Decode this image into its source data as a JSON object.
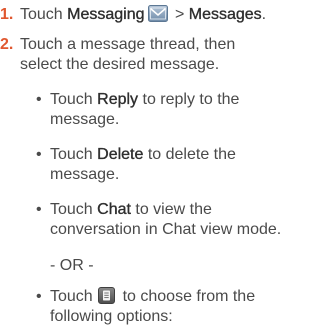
{
  "steps": [
    {
      "number": "1.",
      "parts": [
        "Touch ",
        "Messaging",
        " > ",
        "Messages",
        "."
      ],
      "icon": "messaging-envelope-icon"
    },
    {
      "number": "2.",
      "line1": "Touch a message thread, then",
      "line2": "select the desired message."
    }
  ],
  "bullets": [
    {
      "marker": "•",
      "pre": "Touch ",
      "bold": "Reply",
      "post": " to reply to the",
      "line2": "message."
    },
    {
      "marker": "•",
      "pre": "Touch ",
      "bold": "Delete",
      "post": " to delete the",
      "line2": "message."
    },
    {
      "marker": "•",
      "pre": "Touch ",
      "bold": "Chat",
      "post": " to view the",
      "line2": "conversation in Chat view mode."
    }
  ],
  "or_text": "- OR -",
  "last_bullet": {
    "marker": "•",
    "pre": "Touch ",
    "icon": "menu-icon",
    "post": " to choose from the",
    "line2": "following options:"
  },
  "colors": {
    "step_number": "#e0572f",
    "text": "#4a4a4a"
  }
}
